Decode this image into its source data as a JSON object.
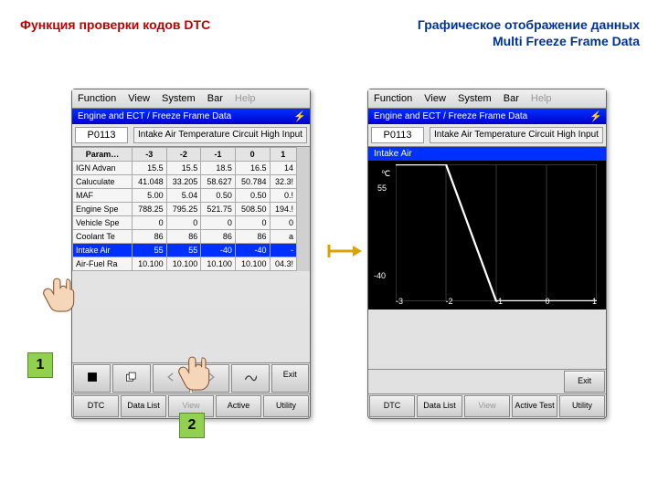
{
  "titles": {
    "left": "Функция проверки кодов DTC",
    "right": "Графическое отображение данных Multi Freeze Frame Data"
  },
  "menu": {
    "function": "Function",
    "view": "View",
    "system": "System",
    "bar": "Bar",
    "help": "Help"
  },
  "header": {
    "bar": "Engine and ECT / Freeze Frame Data",
    "code": "P0113",
    "desc": "Intake Air Temperature Circuit High Input"
  },
  "table": {
    "headers": {
      "param": "Param…",
      "c0": "-3",
      "c1": "-2",
      "c2": "-1",
      "c3": "0",
      "c4": "1"
    },
    "rows": [
      {
        "name": "IGN Advan",
        "v": [
          "15.5",
          "15.5",
          "18.5",
          "16.5",
          "14"
        ],
        "hl": false
      },
      {
        "name": "Caluculate",
        "v": [
          "41.048",
          "33.205",
          "58.627",
          "50.784",
          "32.3!"
        ],
        "hl": false
      },
      {
        "name": "MAF",
        "v": [
          "5.00",
          "5.04",
          "0.50",
          "0.50",
          "0.!"
        ],
        "hl": false
      },
      {
        "name": "Engine Spe",
        "v": [
          "788.25",
          "795.25",
          "521.75",
          "508.50",
          "194.!"
        ],
        "hl": false
      },
      {
        "name": "Vehicle Spe",
        "v": [
          "0",
          "0",
          "0",
          "0",
          "0"
        ],
        "hl": false
      },
      {
        "name": "Coolant Te",
        "v": [
          "86",
          "86",
          "86",
          "86",
          "a"
        ],
        "hl": false
      },
      {
        "name": "Intake Air",
        "v": [
          "55",
          "55",
          "-40",
          "-40",
          "-"
        ],
        "hl": true
      },
      {
        "name": "Air-Fuel Ra",
        "v": [
          "10.100",
          "10.100",
          "10.100",
          "10.100",
          "04.3!"
        ],
        "hl": false
      }
    ]
  },
  "graph": {
    "title": "Intake Air",
    "unit": "℃",
    "ymax": "55",
    "ymin": "-40",
    "xticks": [
      "-3",
      "-2",
      "-1",
      "0",
      "1"
    ]
  },
  "buttons": {
    "exit": "Exit",
    "dtc": "DTC",
    "datalist": "Data List",
    "view": "View",
    "active": "Active Test",
    "active_short": "Active",
    "utility": "Utility"
  },
  "badges": {
    "one": "1",
    "two": "2"
  },
  "chart_data": {
    "type": "line",
    "title": "Intake Air",
    "ylabel": "℃",
    "ylim": [
      -40,
      55
    ],
    "categories": [
      "-3",
      "-2",
      "-1",
      "0",
      "1"
    ],
    "values": [
      55,
      55,
      -40,
      -40,
      -40
    ]
  }
}
